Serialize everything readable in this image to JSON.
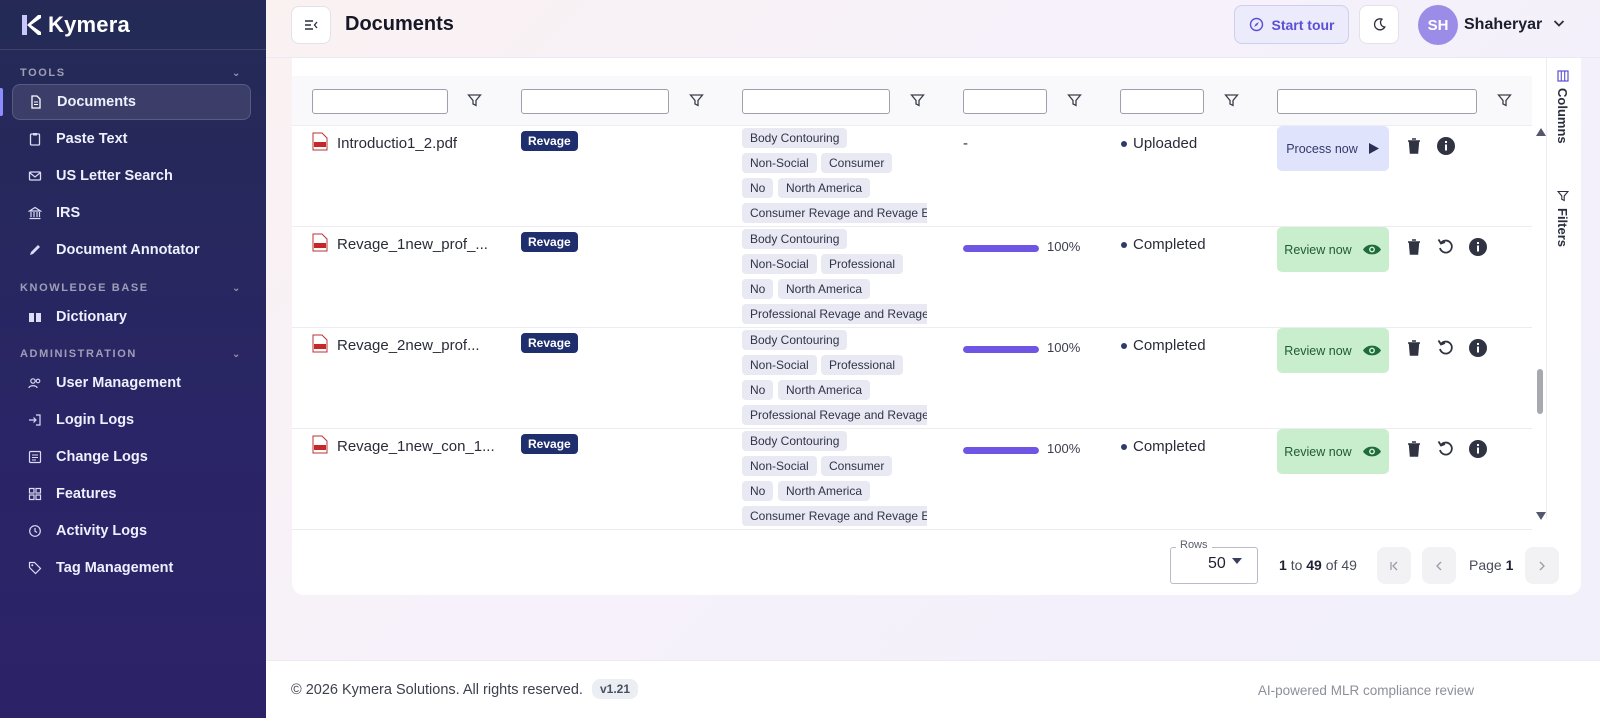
{
  "brand": {
    "name": "Kymera"
  },
  "sidebar": {
    "sections": [
      {
        "label": "TOOLS"
      },
      {
        "label": "KNOWLEDGE BASE"
      },
      {
        "label": "ADMINISTRATION"
      }
    ],
    "items": [
      {
        "label": "Documents",
        "icon": "document-icon",
        "active": true
      },
      {
        "label": "Paste Text",
        "icon": "clipboard-icon"
      },
      {
        "label": "US Letter Search",
        "icon": "mail-icon"
      },
      {
        "label": "IRS",
        "icon": "bank-icon"
      },
      {
        "label": "Document Annotator",
        "icon": "pencil-icon"
      },
      {
        "label": "Dictionary",
        "icon": "book-icon"
      },
      {
        "label": "User Management",
        "icon": "users-icon"
      },
      {
        "label": "Login Logs",
        "icon": "login-icon"
      },
      {
        "label": "Change Logs",
        "icon": "log-icon"
      },
      {
        "label": "Features",
        "icon": "grid-icon"
      },
      {
        "label": "Activity Logs",
        "icon": "history-icon"
      },
      {
        "label": "Tag Management",
        "icon": "tag-icon"
      }
    ]
  },
  "header": {
    "title": "Documents",
    "tour_label": "Start tour",
    "avatar_initials": "SH",
    "user_name": "Shaheryar"
  },
  "side_tabs": {
    "columns": "Columns",
    "filters": "Filters"
  },
  "rows": [
    {
      "file_name": "Introductio1_2.pdf",
      "brand": "Revage",
      "tags": [
        "Body Contouring",
        "Non-Social",
        "Consumer",
        "No",
        "North America",
        "Consumer Revage and Revage El"
      ],
      "progress_text": "-",
      "status": "Uploaded",
      "action": "Process now"
    },
    {
      "file_name": "Revage_1new_prof_...",
      "brand": "Revage",
      "tags": [
        "Body Contouring",
        "Non-Social",
        "Professional",
        "No",
        "North America",
        "Professional Revage and Revage"
      ],
      "progress": 100,
      "progress_text": "100%",
      "status": "Completed",
      "action": "Review now"
    },
    {
      "file_name": "Revage_2new_prof...",
      "brand": "Revage",
      "tags": [
        "Body Contouring",
        "Non-Social",
        "Professional",
        "No",
        "North America",
        "Professional Revage and Revage"
      ],
      "progress": 100,
      "progress_text": "100%",
      "status": "Completed",
      "action": "Review now"
    },
    {
      "file_name": "Revage_1new_con_1...",
      "brand": "Revage",
      "tags": [
        "Body Contouring",
        "Non-Social",
        "Consumer",
        "No",
        "North America",
        "Consumer Revage and Revage El"
      ],
      "progress": 100,
      "progress_text": "100%",
      "status": "Completed",
      "action": "Review now"
    }
  ],
  "paginator": {
    "rows_label": "Rows",
    "rows_value": "50",
    "range_start": "1",
    "range_to": "to",
    "range_end": "49",
    "range_of": "of",
    "range_total": "49",
    "page_label": "Page",
    "page_value": "1"
  },
  "footer": {
    "copyright": "© 2026 Kymera Solutions. All rights reserved.",
    "version": "v1.21",
    "tagline": "AI-powered MLR compliance review"
  },
  "colors": {
    "sidebar": "#2a2566",
    "accent": "#6f55e3",
    "badge": "#1f2f6e",
    "review_bg": "#c9eecd",
    "process_bg": "#dfe3fb"
  }
}
